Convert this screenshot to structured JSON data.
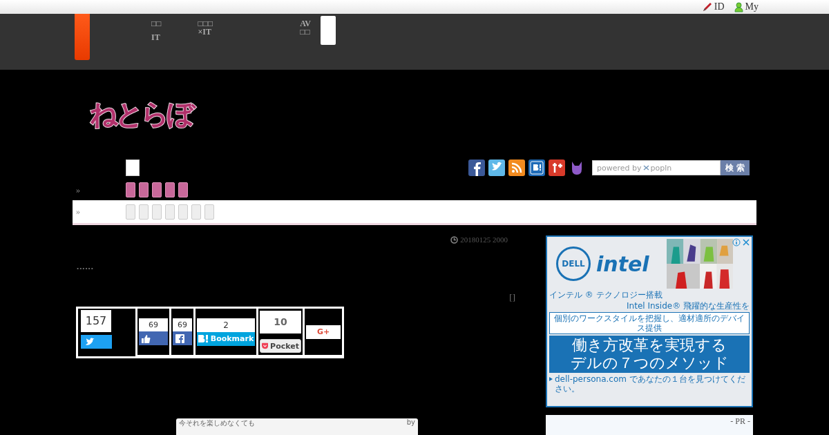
{
  "top_links": [
    {
      "label": "ID",
      "kind": "pencil"
    },
    {
      "label": "My",
      "kind": "person"
    }
  ],
  "nav": [
    {
      "lines": [
        "□□",
        "IT"
      ]
    },
    {
      "lines": [
        "□□□",
        "×IT"
      ]
    },
    {
      "lines": [
        "AV",
        "□□"
      ]
    }
  ],
  "logo": "ねとらぼ",
  "search": {
    "brand_prefix": "powered by",
    "brand": "popln",
    "button": "検 索"
  },
  "crumbs": [
    {
      "marker": "»"
    },
    {
      "marker": "»"
    }
  ],
  "article": {
    "date": "20180125 2000",
    "dots": "••••••",
    "bracket": "[]"
  },
  "share": {
    "twitter_count": "157",
    "like_count": "69",
    "facebook_count": "69",
    "hatena_count": "2",
    "hatena_label": "Bookmark",
    "pocket_count": "10",
    "pocket_label": "Pocket",
    "gplus_label": "G+"
  },
  "embed": {
    "title": "今それを楽しめなくても",
    "byline": "by"
  },
  "ad": {
    "brand_1": "DELL",
    "brand_2": "intel",
    "tagline_1": "インテル ® テクノロジー搭載",
    "tagline_2": "Intel Inside® 飛躍的な生産性を",
    "subhead": "個別のワークスタイルを把握し、適材適所のデバイス提供",
    "headline_1": "働き方改革を実現する",
    "headline_2": "デルの７つのメソッド",
    "link": "dell-persona.com であなたの１台を見つけてください。"
  },
  "pr_label": "- PR -"
}
